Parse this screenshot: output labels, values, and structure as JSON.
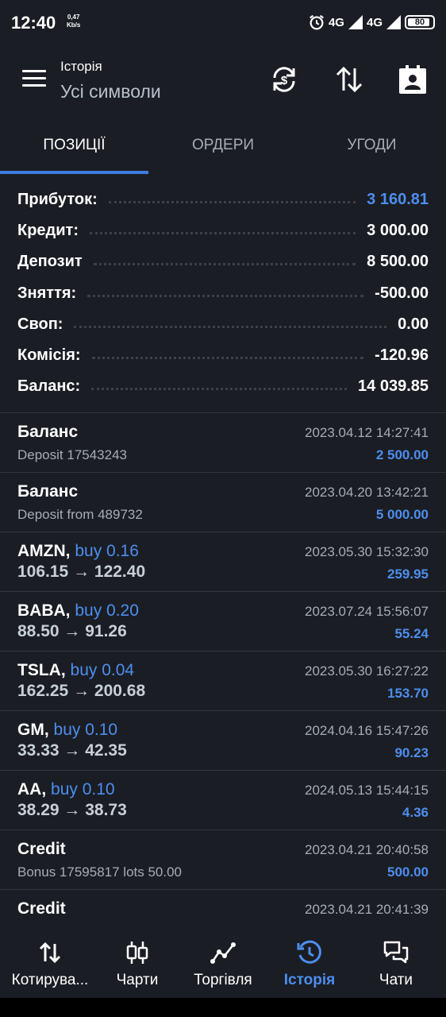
{
  "status_bar": {
    "time": "12:40",
    "speed_value": "0,47",
    "speed_unit": "Kb/s",
    "network_1": "4G",
    "network_2": "4G",
    "battery": "80"
  },
  "header": {
    "subtitle": "Історія",
    "title": "Усі символи",
    "icons": [
      "sync-currency-icon",
      "sort-icon",
      "contact-card-icon"
    ]
  },
  "tabs": [
    {
      "label": "ПОЗИЦІЇ",
      "active": true
    },
    {
      "label": "ОРДЕРИ",
      "active": false
    },
    {
      "label": "УГОДИ",
      "active": false
    }
  ],
  "summary": [
    {
      "label": "Прибуток:",
      "value": "3 160.81",
      "highlight": true
    },
    {
      "label": "Кредит:",
      "value": "3 000.00"
    },
    {
      "label": "Депозит",
      "value": "8 500.00"
    },
    {
      "label": "Зняття:",
      "value": "-500.00"
    },
    {
      "label": "Своп:",
      "value": "0.00"
    },
    {
      "label": "Комісія:",
      "value": "-120.96"
    },
    {
      "label": "Баланс:",
      "value": "14 039.85"
    }
  ],
  "items": [
    {
      "title": "Баланс",
      "subtitle": "Deposit 17543243",
      "date": "2023.04.12 14:27:41",
      "amount": "2 500.00"
    },
    {
      "title": "Баланс",
      "subtitle": "Deposit from 489732",
      "date": "2023.04.20 13:42:21",
      "amount": "5 000.00"
    },
    {
      "symbol": "AMZN,",
      "side": "buy 0.16",
      "prices": "106.15 → 122.40",
      "date": "2023.05.30 15:32:30",
      "amount": "259.95"
    },
    {
      "symbol": "BABA,",
      "side": "buy 0.20",
      "prices": "88.50 → 91.26",
      "date": "2023.07.24 15:56:07",
      "amount": "55.24"
    },
    {
      "symbol": "TSLA,",
      "side": "buy 0.04",
      "prices": "162.25 → 200.68",
      "date": "2023.05.30 16:27:22",
      "amount": "153.70"
    },
    {
      "symbol": "GM,",
      "side": "buy 0.10",
      "prices": "33.33 → 42.35",
      "date": "2024.04.16 15:47:26",
      "amount": "90.23"
    },
    {
      "symbol": "AA,",
      "side": "buy 0.10",
      "prices": "38.29 → 38.73",
      "date": "2024.05.13 15:44:15",
      "amount": "4.36"
    },
    {
      "title": "Credit",
      "subtitle": "Bonus 17595817 lots 50.00",
      "date": "2023.04.21 20:40:58",
      "amount": "500.00"
    },
    {
      "title": "Credit",
      "subtitle": "",
      "date": "2023.04.21 20:41:39",
      "amount": ""
    }
  ],
  "bottom_nav": [
    {
      "label": "Котирува...",
      "icon": "quotes-arrows-icon",
      "active": false
    },
    {
      "label": "Чарти",
      "icon": "candlestick-chart-icon",
      "active": false
    },
    {
      "label": "Торгівля",
      "icon": "trade-line-chart-icon",
      "active": false
    },
    {
      "label": "Історія",
      "icon": "history-clock-icon",
      "active": true
    },
    {
      "label": "Чати",
      "icon": "chat-bubbles-icon",
      "active": false
    }
  ],
  "colors": {
    "background": "#1a1d23",
    "accent": "#4d8eef",
    "tab_indicator": "#3d7de0",
    "text_secondary": "#a6adb6",
    "divider": "#323842"
  }
}
